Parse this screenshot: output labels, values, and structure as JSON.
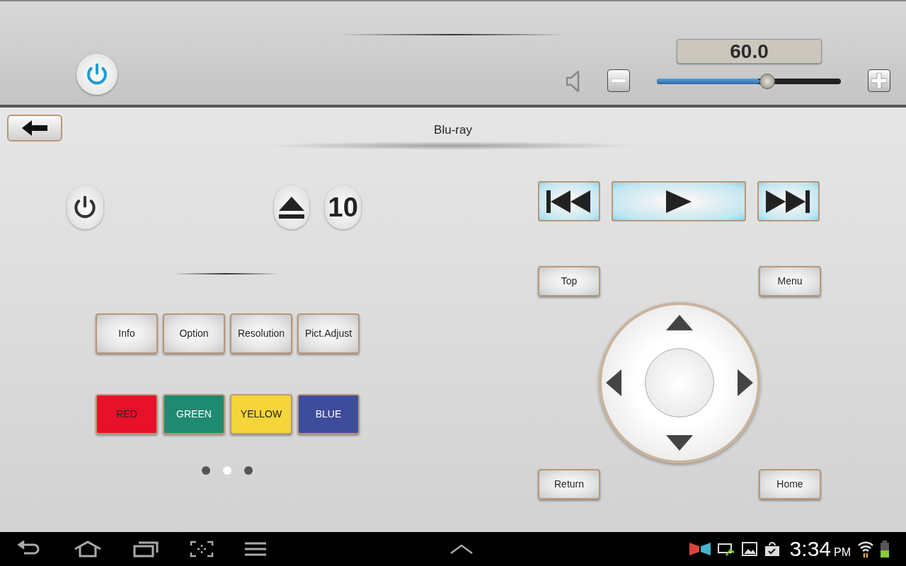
{
  "volume": {
    "reading": "60.0",
    "level": 0.6
  },
  "title": "Blu-ray",
  "disc_button": {
    "label": "10"
  },
  "function_buttons": [
    {
      "label": "Info"
    },
    {
      "label": "Option"
    },
    {
      "label": "Resolution"
    },
    {
      "label": "Pict.Adjust"
    }
  ],
  "color_buttons": [
    {
      "label": "RED",
      "color": "#e8102a"
    },
    {
      "label": "GREEN",
      "color": "#1f8a70"
    },
    {
      "label": "YELLOW",
      "color": "#f5d53a"
    },
    {
      "label": "BLUE",
      "color": "#3e4c9c"
    }
  ],
  "page_dots": [
    {
      "selected": false
    },
    {
      "selected": true
    },
    {
      "selected": false
    }
  ],
  "nav_buttons": {
    "top": "Top",
    "menu": "Menu",
    "return": "Return",
    "home": "Home"
  },
  "status_bar": {
    "time": "3:34",
    "ampm": "PM"
  }
}
